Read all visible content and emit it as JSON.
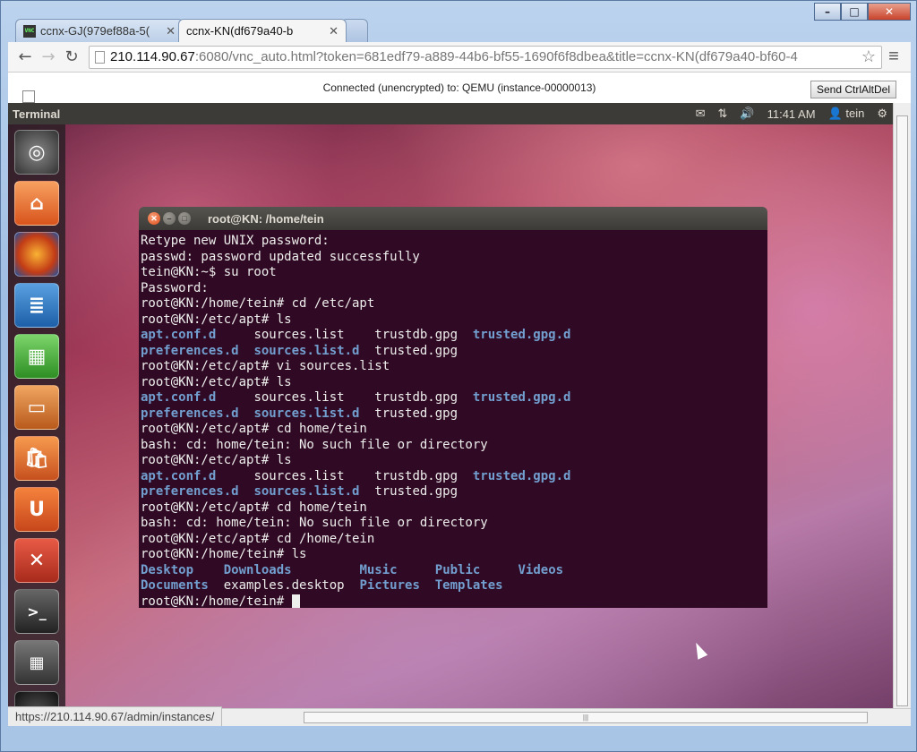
{
  "browser": {
    "tabs": [
      {
        "label": "ccnx-GJ(979ef88a-5(",
        "active": false,
        "favicon": "vnc-icon"
      },
      {
        "label": "ccnx-KN(df679a40-b",
        "active": true,
        "favicon": "page-icon"
      }
    ],
    "url_host": "210.114.90.67",
    "url_rest": ":6080/vnc_auto.html?token=681edf79-a889-44b6-bf55-1690f6f8dbea&title=ccnx-KN(df679a40-bf60-4",
    "status_url": "https://210.114.90.67/admin/instances/"
  },
  "vnc": {
    "status": "Connected (unencrypted) to: QEMU (instance-00000013)",
    "ctrl_alt_del_label": "Send CtrlAltDel"
  },
  "ubuntu": {
    "app_name": "Terminal",
    "time": "11:41 AM",
    "user": "tein",
    "launcher": [
      "dash-icon",
      "files-icon",
      "firefox-icon",
      "writer-icon",
      "calc-icon",
      "impress-icon",
      "software-center-icon",
      "ubuntu-one-icon",
      "settings-icon",
      "terminal-icon",
      "workspaces-icon",
      "trash-icon"
    ]
  },
  "terminal": {
    "title": "root@KN: /home/tein",
    "lines": [
      [
        {
          "t": "Retype new UNIX password:"
        }
      ],
      [
        {
          "t": "passwd: password updated successfully"
        }
      ],
      [
        {
          "t": "tein@KN:~$ su root"
        }
      ],
      [
        {
          "t": "Password:"
        }
      ],
      [
        {
          "t": "root@KN:/home/tein# cd /etc/apt"
        }
      ],
      [
        {
          "t": "root@KN:/etc/apt# ls"
        }
      ],
      [
        {
          "t": "apt.conf.d",
          "d": 1
        },
        {
          "t": "     sources.list    trustdb.gpg  "
        },
        {
          "t": "trusted.gpg.d",
          "d": 1
        }
      ],
      [
        {
          "t": "preferences.d",
          "d": 1
        },
        {
          "t": "  "
        },
        {
          "t": "sources.list.d",
          "d": 1
        },
        {
          "t": "  trusted.gpg"
        }
      ],
      [
        {
          "t": "root@KN:/etc/apt# vi sources.list"
        }
      ],
      [
        {
          "t": "root@KN:/etc/apt# ls"
        }
      ],
      [
        {
          "t": "apt.conf.d",
          "d": 1
        },
        {
          "t": "     sources.list    trustdb.gpg  "
        },
        {
          "t": "trusted.gpg.d",
          "d": 1
        }
      ],
      [
        {
          "t": "preferences.d",
          "d": 1
        },
        {
          "t": "  "
        },
        {
          "t": "sources.list.d",
          "d": 1
        },
        {
          "t": "  trusted.gpg"
        }
      ],
      [
        {
          "t": "root@KN:/etc/apt# cd home/tein"
        }
      ],
      [
        {
          "t": "bash: cd: home/tein: No such file or directory"
        }
      ],
      [
        {
          "t": "root@KN:/etc/apt# ls"
        }
      ],
      [
        {
          "t": "apt.conf.d",
          "d": 1
        },
        {
          "t": "     sources.list    trustdb.gpg  "
        },
        {
          "t": "trusted.gpg.d",
          "d": 1
        }
      ],
      [
        {
          "t": "preferences.d",
          "d": 1
        },
        {
          "t": "  "
        },
        {
          "t": "sources.list.d",
          "d": 1
        },
        {
          "t": "  trusted.gpg"
        }
      ],
      [
        {
          "t": "root@KN:/etc/apt# cd home/tein"
        }
      ],
      [
        {
          "t": "bash: cd: home/tein: No such file or directory"
        }
      ],
      [
        {
          "t": "root@KN:/etc/apt# cd /home/tein"
        }
      ],
      [
        {
          "t": "root@KN:/home/tein# ls"
        }
      ],
      [
        {
          "t": "Desktop",
          "d": 1
        },
        {
          "t": "    "
        },
        {
          "t": "Downloads",
          "d": 1
        },
        {
          "t": "         "
        },
        {
          "t": "Music",
          "d": 1
        },
        {
          "t": "     "
        },
        {
          "t": "Public",
          "d": 1
        },
        {
          "t": "     "
        },
        {
          "t": "Videos",
          "d": 1
        }
      ],
      [
        {
          "t": "Documents",
          "d": 1
        },
        {
          "t": "  examples.desktop  "
        },
        {
          "t": "Pictures",
          "d": 1
        },
        {
          "t": "  "
        },
        {
          "t": "Templates",
          "d": 1
        }
      ],
      [
        {
          "t": "root@KN:/home/tein# "
        }
      ]
    ]
  },
  "colors": {
    "terminal_bg": "#300a24",
    "dir_color": "#729fcf",
    "topbar": "#3c3b37"
  }
}
